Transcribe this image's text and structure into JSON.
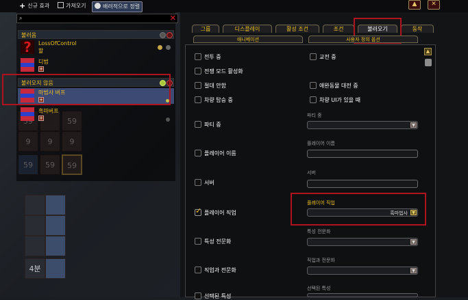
{
  "topbar": {
    "new_effect": "신규 효과",
    "import": "가져오기",
    "sort": "배려적으로 정렬",
    "corner_up": "▲",
    "corner_close": "✕"
  },
  "search": {
    "placeholder": ""
  },
  "left": {
    "group1": "불러옴",
    "item1_label": "LossOfControl",
    "item1_sub": "할",
    "item2_label": "디법",
    "group2": "불러오지 않음",
    "item3_label": "마법사 버프",
    "item4_label": "흑마버프"
  },
  "grid": [
    "59",
    "59",
    "9",
    "9",
    "59",
    "9",
    "59"
  ],
  "bottom_cells": [
    "4분"
  ],
  "tabs": [
    "그룹",
    "디스플레이",
    "활성 조건",
    "조건",
    "불러오기",
    "동작"
  ],
  "subtabs": [
    "애니메이션",
    "사용자 정의 옵션"
  ],
  "options": {
    "combat": "전투 중",
    "pvp": "교전 중",
    "warmode": "전쟁 모드 활성화",
    "resting": "절대 안함",
    "pet_battle": "애완동물 대전 중",
    "vehicle": "차량 탑승 중",
    "vehicle_ui": "차량 UI가 있을 때",
    "party": "파티 중",
    "party_label": "파티 중",
    "player_name": "플레이어 이름",
    "player_name_label": "플레이어 이름",
    "server": "서버",
    "server_label": "서버",
    "player_class": "플레이어 직업",
    "player_class_label": "플레이어 직업",
    "player_class_value": "흑마법사",
    "spec": "특성 전문화",
    "spec_label": "특성 전문화",
    "class_spec": "직업과 전문화",
    "class_spec_label": "직업과 전문화",
    "talent": "선택된 특성",
    "talent_label": "선택된 특성"
  },
  "colors": {
    "accent": "#f0c020",
    "highlight": "#b0121e",
    "selected": "#3d4a73"
  }
}
